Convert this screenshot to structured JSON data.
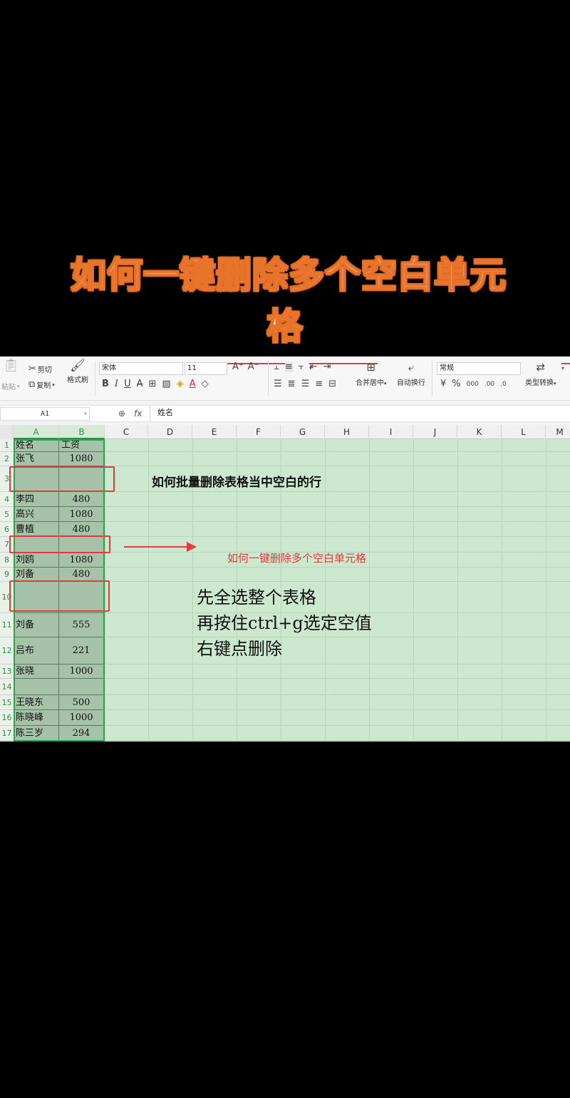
{
  "title": {
    "line1": "如何一键删除多个空白单元",
    "line2": "格"
  },
  "ribbon": {
    "paste": "粘贴",
    "cut": "剪切",
    "copy": "复制",
    "format_painter": "格式刷",
    "font_name": "宋体",
    "font_size": "11",
    "merge_center": "合并居中",
    "wrap_text": "自动换行",
    "number_format": "常规",
    "type_convert": "类型转换"
  },
  "formula_bar": {
    "name_box": "A1",
    "fx": "fx",
    "content": "姓名"
  },
  "columns": [
    "A",
    "B",
    "C",
    "D",
    "E",
    "F",
    "G",
    "H",
    "I",
    "J",
    "K",
    "L",
    "M"
  ],
  "rows": [
    {
      "num": "1",
      "name": "姓名",
      "value": "工资"
    },
    {
      "num": "2",
      "name": "张飞",
      "value": "1080"
    },
    {
      "num": "3",
      "name": "",
      "value": ""
    },
    {
      "num": "4",
      "name": "李四",
      "value": "480"
    },
    {
      "num": "5",
      "name": "高兴",
      "value": "1080"
    },
    {
      "num": "6",
      "name": "曹植",
      "value": "480"
    },
    {
      "num": "7",
      "name": "",
      "value": ""
    },
    {
      "num": "8",
      "name": "刘鸥",
      "value": "1080"
    },
    {
      "num": "9",
      "name": "刘备",
      "value": "480"
    },
    {
      "num": "10",
      "name": "",
      "value": ""
    },
    {
      "num": "11",
      "name": "刘备",
      "value": "555"
    },
    {
      "num": "12",
      "name": "吕布",
      "value": "221"
    },
    {
      "num": "13",
      "name": "张晓",
      "value": "1000"
    },
    {
      "num": "14",
      "name": "",
      "value": ""
    },
    {
      "num": "15",
      "name": "王晓东",
      "value": "500"
    },
    {
      "num": "16",
      "name": "陈晓峰",
      "value": "1000"
    },
    {
      "num": "17",
      "name": "陈三岁",
      "value": "294"
    }
  ],
  "annotations": {
    "heading": "如何批量删除表格当中空白的行",
    "arrow_label": "如何一键删除多个空白单元格",
    "step1": "先全选整个表格",
    "step2": "再按住ctrl+g选定空值",
    "step3": "右键点删除"
  },
  "colors": {
    "accent_green": "#2aa34a",
    "highlight_red": "#e23b3b",
    "title_outline": "#e8732a",
    "sheet_bg": "#cce8cf"
  }
}
